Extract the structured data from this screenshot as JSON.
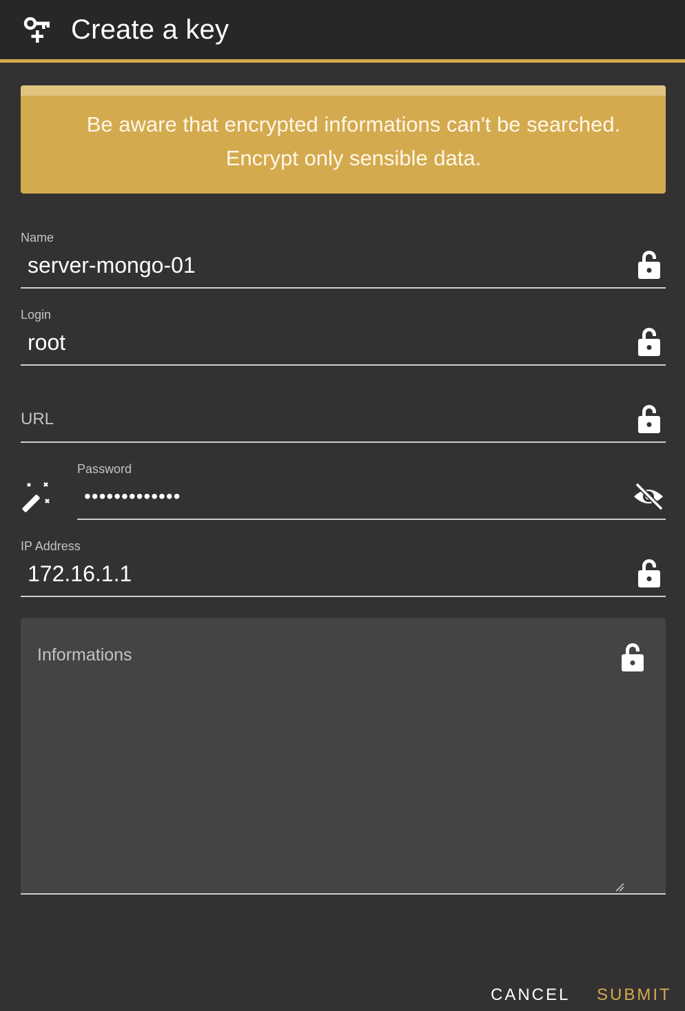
{
  "dialog": {
    "title": "Create a key",
    "icon": "key-plus-icon"
  },
  "alert": {
    "line1": "Be aware that encrypted informations can't be searched.",
    "line2": "Encrypt only sensible data."
  },
  "fields": {
    "name": {
      "label": "Name",
      "value": "server-mongo-01",
      "icon": "lock-open-icon"
    },
    "login": {
      "label": "Login",
      "value": "root",
      "icon": "lock-open-icon"
    },
    "url": {
      "placeholder": "URL",
      "value": "",
      "icon": "lock-open-icon"
    },
    "password": {
      "label": "Password",
      "value": "•••••••••••••",
      "icon": "eye-off-icon",
      "generator_icon": "magic-wand-icon"
    },
    "ip": {
      "label": "IP Address",
      "value": "172.16.1.1",
      "icon": "lock-open-icon"
    },
    "informations": {
      "placeholder": "Informations",
      "value": "",
      "icon": "lock-open-icon"
    }
  },
  "actions": {
    "cancel": "CANCEL",
    "submit": "SUBMIT"
  },
  "colors": {
    "accent": "#d4aa4f",
    "background": "#333132",
    "header": "#282728"
  }
}
